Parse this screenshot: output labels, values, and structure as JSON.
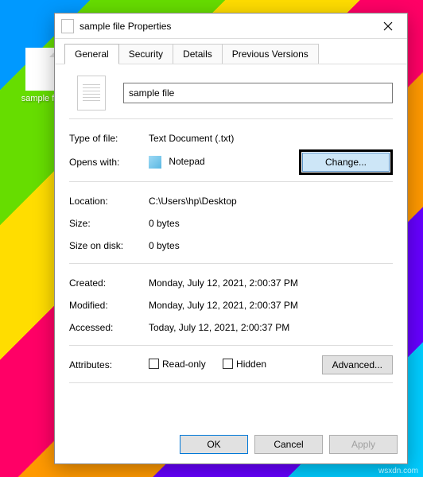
{
  "desktop": {
    "item_label": "sample file"
  },
  "dialog": {
    "title": "sample file Properties",
    "tabs": {
      "general": "General",
      "security": "Security",
      "details": "Details",
      "previous": "Previous Versions"
    },
    "filename": "sample file",
    "type_label": "Type of file:",
    "type_value": "Text Document (.txt)",
    "opens_label": "Opens with:",
    "opens_value": "Notepad",
    "change_btn": "Change...",
    "location_label": "Location:",
    "location_value": "C:\\Users\\hp\\Desktop",
    "size_label": "Size:",
    "size_value": "0 bytes",
    "sizeondisk_label": "Size on disk:",
    "sizeondisk_value": "0 bytes",
    "created_label": "Created:",
    "created_value": "Monday, July 12, 2021, 2:00:37 PM",
    "modified_label": "Modified:",
    "modified_value": "Monday, July 12, 2021, 2:00:37 PM",
    "accessed_label": "Accessed:",
    "accessed_value": "Today, July 12, 2021, 2:00:37 PM",
    "attributes_label": "Attributes:",
    "readonly_label": "Read-only",
    "hidden_label": "Hidden",
    "advanced_btn": "Advanced...",
    "ok_btn": "OK",
    "cancel_btn": "Cancel",
    "apply_btn": "Apply"
  },
  "watermark": "wsxdn.com"
}
